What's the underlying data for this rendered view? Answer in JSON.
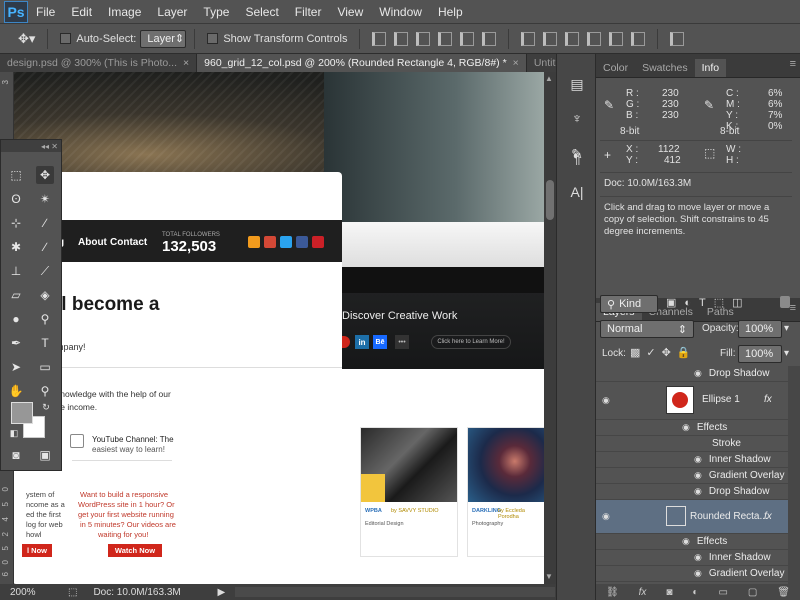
{
  "app": {
    "logo": "Ps"
  },
  "menu": [
    "File",
    "Edit",
    "Image",
    "Layer",
    "Type",
    "Select",
    "Filter",
    "View",
    "Window",
    "Help"
  ],
  "options": {
    "auto_select_label": "Auto-Select:",
    "auto_select_value": "Layer",
    "transform_label": "Show Transform Controls"
  },
  "tabs": [
    {
      "label": "design.psd @ 300% (This is Photo...",
      "close": "×"
    },
    {
      "label": "960_grid_12_col.psd @ 200% (Rounded Rectangle 4, RGB/8#) *",
      "close": "×"
    },
    {
      "label": "Untitled",
      "more": "»"
    }
  ],
  "rulers": {
    "left": [
      "3",
      "4",
      "1",
      "5",
      "0",
      "0",
      "5",
      "4",
      "2",
      "5",
      "0",
      "6"
    ]
  },
  "canvas": {
    "nav": [
      "g",
      "About",
      "Contact"
    ],
    "followers_label": "TOTAL FOLLOWERS",
    "followers": "132,503",
    "headline": "ll become a",
    "subline": "mpany!",
    "knowledge1": "knowledge with the help of our",
    "knowledge2": "ve income.",
    "yt_title": "YouTube Channel: The",
    "yt_sub": "easiest way to learn!",
    "left_col": [
      "ystem of",
      "ncome as a",
      "ed the first",
      "log for web",
      "howl"
    ],
    "mid_col": [
      "Want to build a responsive",
      "WordPress site in 1 hour? Or",
      "get your first website running",
      "in 5 minutes? Our videos are",
      "waiting for you!"
    ],
    "btn_now": "l Now",
    "btn_watch": "Watch Now",
    "discover": "Discover Creative Work",
    "learn": "Click here to Learn More!",
    "cards": [
      {
        "title": "WPBA",
        "by": "by SAVVY STUDIO",
        "cat": "Editorial Design"
      },
      {
        "title": "DARKLING",
        "by": "by Eccleda Porodha",
        "cat": "Photography"
      }
    ]
  },
  "status": {
    "zoom": "200%",
    "doc": "Doc: 10.0M/163.3M"
  },
  "panels": {
    "top_tabs": [
      "Color",
      "Swatches",
      "Info"
    ],
    "info": {
      "r": "230",
      "g": "230",
      "b": "230",
      "c": "6%",
      "m": "6%",
      "y": "7%",
      "k": "0%",
      "bit_left": "8-bit",
      "bit_right": "8-bit",
      "x": "1122",
      "y_coord": "412",
      "doc": "Doc: 10.0M/163.3M",
      "hint": "Click and drag to move layer or move a copy of selection. Shift constrains to 45 degree increments."
    },
    "layer_tabs": [
      "Layers",
      "Channels",
      "Paths"
    ],
    "kind": "Kind",
    "blend": "Normal",
    "opacity_label": "Opacity:",
    "opacity": "100%",
    "lock_label": "Lock:",
    "fill_label": "Fill:",
    "fill": "100%",
    "layers": [
      {
        "label": "Drop Shadow",
        "type": "effect"
      },
      {
        "label": "Ellipse 1",
        "type": "layer"
      },
      {
        "label": "Effects",
        "type": "effects"
      },
      {
        "label": "Stroke",
        "type": "effect-noeye"
      },
      {
        "label": "Inner Shadow",
        "type": "effect"
      },
      {
        "label": "Gradient Overlay",
        "type": "effect"
      },
      {
        "label": "Drop Shadow",
        "type": "effect"
      },
      {
        "label": "Rounded Recta...",
        "type": "layer-selected"
      },
      {
        "label": "Effects",
        "type": "effects"
      },
      {
        "label": "Inner Shadow",
        "type": "effect"
      },
      {
        "label": "Gradient Overlay",
        "type": "effect"
      }
    ],
    "fx": "fx"
  },
  "colors": {
    "ps_blue": "#47b3ff",
    "red": "#d0261b",
    "accent_selected": "#5e6f83"
  }
}
